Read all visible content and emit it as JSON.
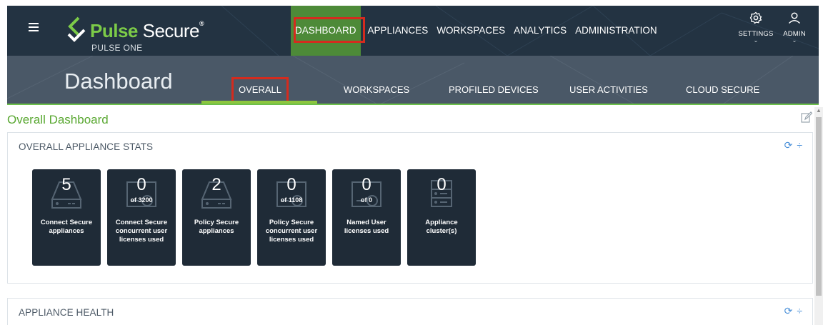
{
  "app": {
    "brand_pulse": "Pulse",
    "brand_secure": "Secure",
    "product": "PULSE ONE"
  },
  "nav": {
    "items": [
      {
        "label": "DASHBOARD",
        "active": true
      },
      {
        "label": "APPLIANCES"
      },
      {
        "label": "WORKSPACES"
      },
      {
        "label": "ANALYTICS"
      },
      {
        "label": "ADMINISTRATION"
      }
    ],
    "settings_label": "SETTINGS",
    "admin_label": "ADMIN"
  },
  "page": {
    "title": "Dashboard",
    "tabs": [
      {
        "label": "OVERALL",
        "active": true
      },
      {
        "label": "WORKSPACES"
      },
      {
        "label": "PROFILED DEVICES"
      },
      {
        "label": "USER ACTIVITIES"
      },
      {
        "label": "CLOUD SECURE"
      }
    ]
  },
  "content": {
    "heading": "Overall Dashboard",
    "stats_panel": {
      "title": "OVERALL APPLIANCE STATS",
      "cards": [
        {
          "value": "5",
          "sub": "",
          "label": "Connect Secure appliances",
          "icon": "server-icon"
        },
        {
          "value": "0",
          "sub": "of 3200",
          "label": "Connect Secure concurrent user licenses used",
          "icon": "license-icon"
        },
        {
          "value": "2",
          "sub": "",
          "label": "Policy Secure appliances",
          "icon": "server-icon"
        },
        {
          "value": "0",
          "sub": "of 1108",
          "label": "Policy Secure concurrent user licenses used",
          "icon": "license-icon"
        },
        {
          "value": "0",
          "sub": "of 0",
          "label": "Named User licenses used",
          "icon": "license-icon"
        },
        {
          "value": "0",
          "sub": "",
          "label": "Appliance cluster(s)",
          "icon": "cluster-icon"
        }
      ]
    },
    "health_panel": {
      "title": "APPLIANCE HEALTH"
    }
  },
  "colors": {
    "topbar": "#233342",
    "subheader": "#4a5867",
    "accent_green": "#5aa832",
    "highlight_red": "#d42b1e",
    "card_bg": "#1f2b37"
  }
}
